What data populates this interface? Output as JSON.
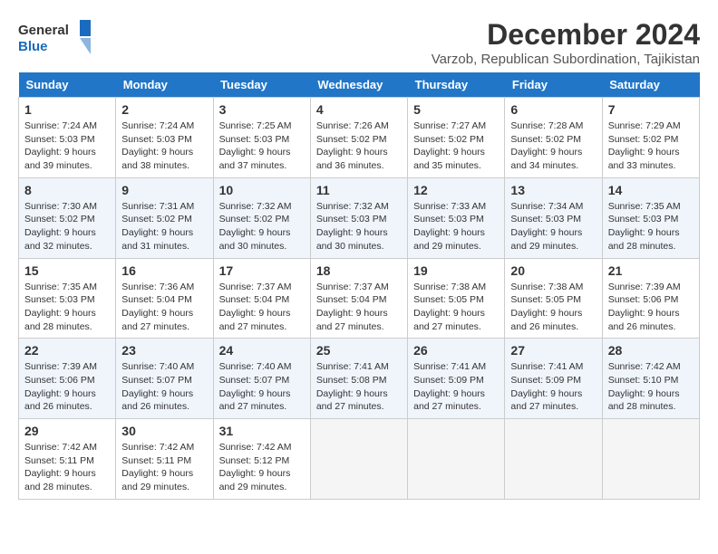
{
  "logo": {
    "line1": "General",
    "line2": "Blue"
  },
  "title": "December 2024",
  "subtitle": "Varzob, Republican Subordination, Tajikistan",
  "days_of_week": [
    "Sunday",
    "Monday",
    "Tuesday",
    "Wednesday",
    "Thursday",
    "Friday",
    "Saturday"
  ],
  "weeks": [
    [
      {
        "num": "1",
        "sunrise": "7:24 AM",
        "sunset": "5:03 PM",
        "daylight": "9 hours and 39 minutes."
      },
      {
        "num": "2",
        "sunrise": "7:24 AM",
        "sunset": "5:03 PM",
        "daylight": "9 hours and 38 minutes."
      },
      {
        "num": "3",
        "sunrise": "7:25 AM",
        "sunset": "5:03 PM",
        "daylight": "9 hours and 37 minutes."
      },
      {
        "num": "4",
        "sunrise": "7:26 AM",
        "sunset": "5:02 PM",
        "daylight": "9 hours and 36 minutes."
      },
      {
        "num": "5",
        "sunrise": "7:27 AM",
        "sunset": "5:02 PM",
        "daylight": "9 hours and 35 minutes."
      },
      {
        "num": "6",
        "sunrise": "7:28 AM",
        "sunset": "5:02 PM",
        "daylight": "9 hours and 34 minutes."
      },
      {
        "num": "7",
        "sunrise": "7:29 AM",
        "sunset": "5:02 PM",
        "daylight": "9 hours and 33 minutes."
      }
    ],
    [
      {
        "num": "8",
        "sunrise": "7:30 AM",
        "sunset": "5:02 PM",
        "daylight": "9 hours and 32 minutes."
      },
      {
        "num": "9",
        "sunrise": "7:31 AM",
        "sunset": "5:02 PM",
        "daylight": "9 hours and 31 minutes."
      },
      {
        "num": "10",
        "sunrise": "7:32 AM",
        "sunset": "5:02 PM",
        "daylight": "9 hours and 30 minutes."
      },
      {
        "num": "11",
        "sunrise": "7:32 AM",
        "sunset": "5:03 PM",
        "daylight": "9 hours and 30 minutes."
      },
      {
        "num": "12",
        "sunrise": "7:33 AM",
        "sunset": "5:03 PM",
        "daylight": "9 hours and 29 minutes."
      },
      {
        "num": "13",
        "sunrise": "7:34 AM",
        "sunset": "5:03 PM",
        "daylight": "9 hours and 29 minutes."
      },
      {
        "num": "14",
        "sunrise": "7:35 AM",
        "sunset": "5:03 PM",
        "daylight": "9 hours and 28 minutes."
      }
    ],
    [
      {
        "num": "15",
        "sunrise": "7:35 AM",
        "sunset": "5:03 PM",
        "daylight": "9 hours and 28 minutes."
      },
      {
        "num": "16",
        "sunrise": "7:36 AM",
        "sunset": "5:04 PM",
        "daylight": "9 hours and 27 minutes."
      },
      {
        "num": "17",
        "sunrise": "7:37 AM",
        "sunset": "5:04 PM",
        "daylight": "9 hours and 27 minutes."
      },
      {
        "num": "18",
        "sunrise": "7:37 AM",
        "sunset": "5:04 PM",
        "daylight": "9 hours and 27 minutes."
      },
      {
        "num": "19",
        "sunrise": "7:38 AM",
        "sunset": "5:05 PM",
        "daylight": "9 hours and 27 minutes."
      },
      {
        "num": "20",
        "sunrise": "7:38 AM",
        "sunset": "5:05 PM",
        "daylight": "9 hours and 26 minutes."
      },
      {
        "num": "21",
        "sunrise": "7:39 AM",
        "sunset": "5:06 PM",
        "daylight": "9 hours and 26 minutes."
      }
    ],
    [
      {
        "num": "22",
        "sunrise": "7:39 AM",
        "sunset": "5:06 PM",
        "daylight": "9 hours and 26 minutes."
      },
      {
        "num": "23",
        "sunrise": "7:40 AM",
        "sunset": "5:07 PM",
        "daylight": "9 hours and 26 minutes."
      },
      {
        "num": "24",
        "sunrise": "7:40 AM",
        "sunset": "5:07 PM",
        "daylight": "9 hours and 27 minutes."
      },
      {
        "num": "25",
        "sunrise": "7:41 AM",
        "sunset": "5:08 PM",
        "daylight": "9 hours and 27 minutes."
      },
      {
        "num": "26",
        "sunrise": "7:41 AM",
        "sunset": "5:09 PM",
        "daylight": "9 hours and 27 minutes."
      },
      {
        "num": "27",
        "sunrise": "7:41 AM",
        "sunset": "5:09 PM",
        "daylight": "9 hours and 27 minutes."
      },
      {
        "num": "28",
        "sunrise": "7:42 AM",
        "sunset": "5:10 PM",
        "daylight": "9 hours and 28 minutes."
      }
    ],
    [
      {
        "num": "29",
        "sunrise": "7:42 AM",
        "sunset": "5:11 PM",
        "daylight": "9 hours and 28 minutes."
      },
      {
        "num": "30",
        "sunrise": "7:42 AM",
        "sunset": "5:11 PM",
        "daylight": "9 hours and 29 minutes."
      },
      {
        "num": "31",
        "sunrise": "7:42 AM",
        "sunset": "5:12 PM",
        "daylight": "9 hours and 29 minutes."
      },
      null,
      null,
      null,
      null
    ]
  ]
}
